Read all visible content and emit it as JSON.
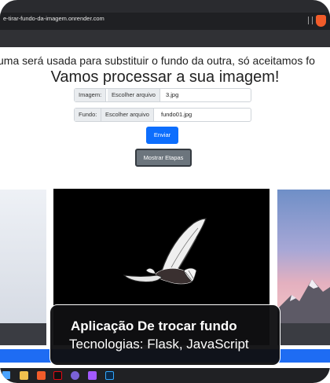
{
  "browser": {
    "url": "e-tirar-fundo-da-imagem.onrender.com"
  },
  "main": {
    "info_text": "uma será usada para substituir o fundo da outra, só aceitamos fo",
    "title": "Vamos processar a sua imagem!",
    "image_field": {
      "label": "Imagem:",
      "choose_label": "Escolher arquivo",
      "filename": "3.jpg"
    },
    "background_field": {
      "label": "Fundo:",
      "choose_label": "Escolher arquivo",
      "filename": "fundo01.jpg"
    },
    "submit_label": "Enviar",
    "show_steps_label": "Mostrar Etapas"
  },
  "caption": {
    "title": "Aplicação De trocar fundo",
    "subtitle": "Tecnologias: Flask, JavaScript"
  },
  "taskbar": {
    "icons": [
      "windows-icon",
      "file-explorer-icon",
      "brave-icon",
      "netflix-icon",
      "chrome-icon",
      "figma-icon",
      "photoshop-icon"
    ]
  },
  "colors": {
    "primary_button": "#0d6efd",
    "secondary_button": "#6c757d",
    "blue_bar": "#1e6cf3",
    "chrome_dark": "#2a2b2f"
  }
}
